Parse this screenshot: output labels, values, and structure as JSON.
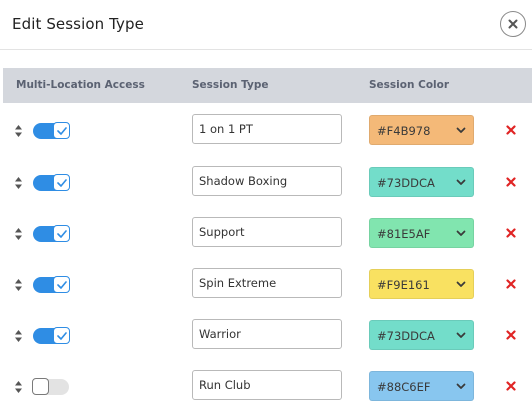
{
  "dialog": {
    "title": "Edit Session Type",
    "close_icon": "close-circle-icon"
  },
  "table": {
    "headers": {
      "access": "Multi-Location Access",
      "session_type": "Session Type",
      "session_color": "Session Color"
    },
    "rows": [
      {
        "enabled": true,
        "name": "1 on 1 PT",
        "color": "#F4B978"
      },
      {
        "enabled": true,
        "name": "Shadow Boxing",
        "color": "#73DDCA"
      },
      {
        "enabled": true,
        "name": "Support",
        "color": "#81E5AF"
      },
      {
        "enabled": true,
        "name": "Spin Extreme",
        "color": "#F9E161"
      },
      {
        "enabled": true,
        "name": "Warrior",
        "color": "#73DDCA"
      },
      {
        "enabled": false,
        "name": "Run Club",
        "color": "#88C6EF"
      }
    ]
  },
  "icons": {
    "reorder": "sort-handle-icon",
    "toggle_check": "checkmark-icon",
    "dropdown": "chevron-down-icon",
    "delete": "delete-x-icon"
  },
  "colors": {
    "toggle_on": "#2F8DE4",
    "toggle_off": "#E3E3E3",
    "delete": "#E02424",
    "header_bg": "#D4D7DD"
  }
}
